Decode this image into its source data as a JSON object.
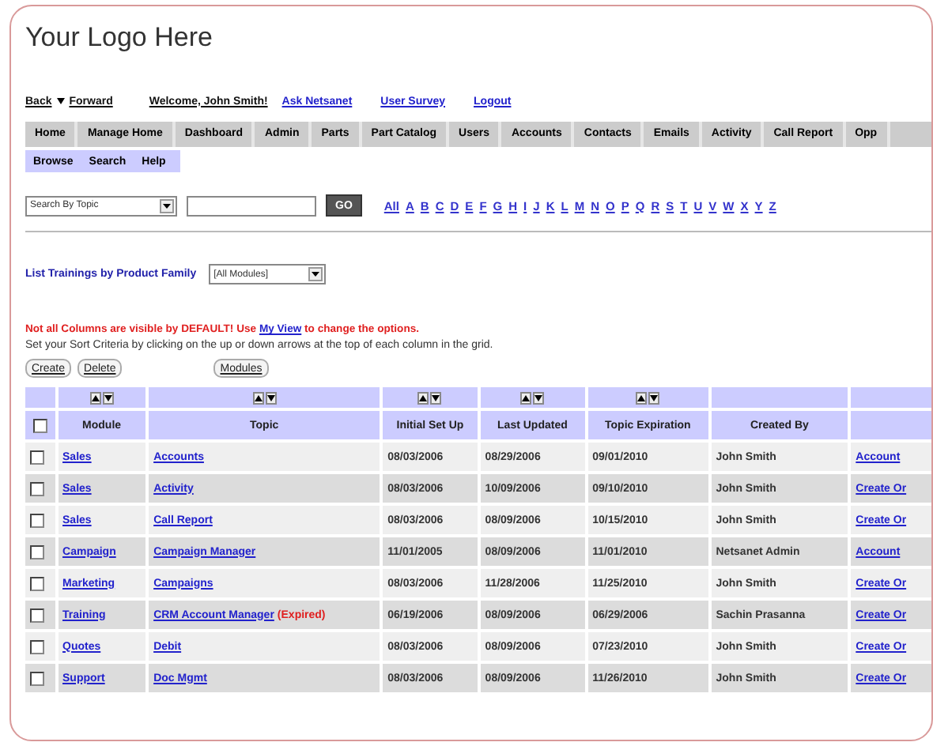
{
  "logo": "Your Logo Here",
  "nav_links": [
    {
      "label": "Back",
      "kind": "plain"
    },
    {
      "label": "Forward",
      "kind": "plain"
    },
    {
      "label": "Welcome, John Smith!",
      "kind": "plain"
    },
    {
      "label": "Ask Netsanet",
      "kind": "link"
    },
    {
      "label": "User Survey",
      "kind": "link"
    },
    {
      "label": "Logout",
      "kind": "link"
    }
  ],
  "menu": [
    {
      "label": "Home"
    },
    {
      "label": "Manage Home"
    },
    {
      "label": "Dashboard"
    },
    {
      "label": "Admin"
    },
    {
      "label": "Parts"
    },
    {
      "label": "Part Catalog"
    },
    {
      "label": "Users"
    },
    {
      "label": "Accounts"
    },
    {
      "label": "Contacts"
    },
    {
      "label": "Emails"
    },
    {
      "label": "Activity"
    },
    {
      "label": "Call Report"
    },
    {
      "label": "Opp"
    }
  ],
  "submenu": [
    {
      "label": "Browse"
    },
    {
      "label": "Search"
    },
    {
      "label": "Help"
    }
  ],
  "search": {
    "mode": "Search By Topic",
    "button": "GO"
  },
  "alphabet": [
    "All",
    "A",
    "B",
    "C",
    "D",
    "E",
    "F",
    "G",
    "H",
    "I",
    "J",
    "K",
    "L",
    "M",
    "N",
    "O",
    "P",
    "Q",
    "R",
    "S",
    "T",
    "U",
    "V",
    "W",
    "X",
    "Y",
    "Z"
  ],
  "filter": {
    "label": "List Trainings by Product Family",
    "value": "[All Modules]"
  },
  "notice": {
    "before": "Not all Columns are visible by DEFAULT! Use ",
    "link": "My View",
    "after": " to change the options."
  },
  "instruction": "Set your Sort Criteria by clicking on the up or down arrows at the top of each column in the grid.",
  "actions": [
    "Create",
    "Delete",
    "Modules"
  ],
  "table": {
    "columns": [
      {
        "label": "Module",
        "sortable": true
      },
      {
        "label": "Topic",
        "sortable": true
      },
      {
        "label": "Initial Set Up",
        "sortable": true
      },
      {
        "label": "Last Updated",
        "sortable": true
      },
      {
        "label": "Topic Expiration",
        "sortable": true
      },
      {
        "label": "Created By",
        "sortable": false
      },
      {
        "sortable": false
      }
    ],
    "select_all": {
      "checked": false
    },
    "rows": [
      {
        "checked": false,
        "module": "Sales",
        "topic": "Accounts",
        "initial": "08/03/2006",
        "updated": "08/29/2006",
        "expiration": "09/01/2010",
        "created_by": "John Smith",
        "action": "Account"
      },
      {
        "checked": false,
        "module": "Sales",
        "topic": "Activity",
        "initial": "08/03/2006",
        "updated": "10/09/2006",
        "expiration": "09/10/2010",
        "created_by": "John Smith",
        "action": "Create Or"
      },
      {
        "checked": false,
        "module": "Sales",
        "topic": "Call Report",
        "initial": "08/03/2006",
        "updated": "08/09/2006",
        "expiration": "10/15/2010",
        "created_by": "John Smith",
        "action": "Create Or"
      },
      {
        "checked": false,
        "module": "Campaign",
        "topic": "Campaign Manager",
        "initial": "11/01/2005",
        "updated": "08/09/2006",
        "expiration": "11/01/2010",
        "created_by": "Netsanet Admin",
        "action": "Account"
      },
      {
        "checked": false,
        "module": "Marketing",
        "topic": "Campaigns",
        "initial": "08/03/2006",
        "updated": "11/28/2006",
        "expiration": "11/25/2010",
        "created_by": "John Smith",
        "action": "Create Or"
      },
      {
        "checked": false,
        "module": "Training",
        "topic": "CRM Account Manager",
        "note": "(Expired)",
        "initial": "06/19/2006",
        "updated": "08/09/2006",
        "expiration": "06/29/2006",
        "created_by": "Sachin Prasanna",
        "action": "Create Or"
      },
      {
        "checked": false,
        "module": "Quotes",
        "topic": "Debit",
        "initial": "08/03/2006",
        "updated": "08/09/2006",
        "expiration": "07/23/2010",
        "created_by": "John Smith",
        "action": "Create Or"
      },
      {
        "checked": false,
        "module": "Support",
        "topic": "Doc Mgmt",
        "initial": "08/03/2006",
        "updated": "08/09/2006",
        "expiration": "11/26/2010",
        "created_by": "John Smith",
        "action": "Create Or"
      }
    ]
  }
}
